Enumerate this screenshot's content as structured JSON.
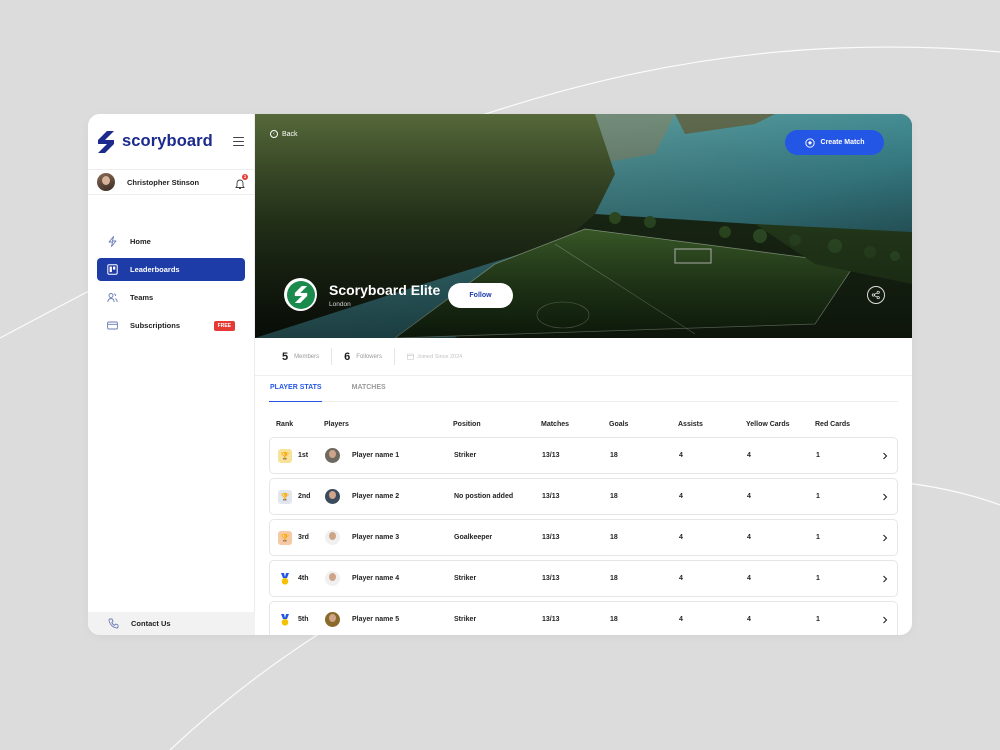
{
  "brand": {
    "name": "scoryboard",
    "color": "#1b2a8c",
    "accent": "#2456e6"
  },
  "user": {
    "name": "Christopher Stinson",
    "notifications": "1"
  },
  "nav": [
    {
      "label": "Home",
      "icon": "lightning-icon",
      "active": false
    },
    {
      "label": "Leaderboards",
      "icon": "board-icon",
      "active": true
    },
    {
      "label": "Teams",
      "icon": "users-icon",
      "active": false
    },
    {
      "label": "Subscriptions",
      "icon": "card-icon",
      "active": false,
      "badge": "FREE"
    }
  ],
  "contact": {
    "label": "Contact Us"
  },
  "hero": {
    "back_label": "Back",
    "create_label": "Create Match",
    "team_name": "Scoryboard Elite",
    "team_location": "London",
    "follow_label": "Follow"
  },
  "stats": {
    "members_count": "5",
    "members_label": "Members",
    "followers_count": "6",
    "followers_label": "Followers",
    "joined_label": "Joined Since 2024"
  },
  "tabs": [
    {
      "label": "PLAYER STATS",
      "active": true
    },
    {
      "label": "MATCHES",
      "active": false
    }
  ],
  "table": {
    "headers": [
      "Rank",
      "Players",
      "Position",
      "Matches",
      "Goals",
      "Assists",
      "Yellow Cards",
      "Red Cards"
    ],
    "rows": [
      {
        "rank": "1st",
        "player": "Player name 1",
        "position": "Striker",
        "matches": "13/13",
        "goals": "18",
        "assists": "4",
        "yellow": "4",
        "red": "1"
      },
      {
        "rank": "2nd",
        "player": "Player name 2",
        "position": "No postion added",
        "matches": "13/13",
        "goals": "18",
        "assists": "4",
        "yellow": "4",
        "red": "1"
      },
      {
        "rank": "3rd",
        "player": "Player name 3",
        "position": "Goalkeeper",
        "matches": "13/13",
        "goals": "18",
        "assists": "4",
        "yellow": "4",
        "red": "1"
      },
      {
        "rank": "4th",
        "player": "Player name 4",
        "position": "Striker",
        "matches": "13/13",
        "goals": "18",
        "assists": "4",
        "yellow": "4",
        "red": "1"
      },
      {
        "rank": "5th",
        "player": "Player name 5",
        "position": "Striker",
        "matches": "13/13",
        "goals": "18",
        "assists": "4",
        "yellow": "4",
        "red": "1"
      }
    ]
  }
}
